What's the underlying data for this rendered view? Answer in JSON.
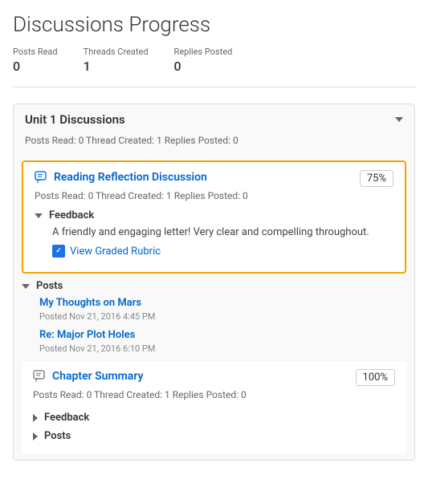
{
  "page": {
    "title": "Discussions Progress"
  },
  "stats": {
    "posts_read_label": "Posts Read",
    "threads_created_label": "Threads Created",
    "replies_posted_label": "Replies Posted",
    "posts_read_value": "0",
    "threads_created_value": "1",
    "replies_posted_value": "0"
  },
  "unit": {
    "title": "Unit 1 Discussions",
    "meta": "Posts Read: 0   Thread Created: 1   Replies Posted: 0"
  },
  "discussion1": {
    "title": "Reading Reflection Discussion",
    "meta": "Posts Read: 0   Thread Created: 1   Replies Posted: 0",
    "score": "75%",
    "feedback_label": "Feedback",
    "feedback_text": "A friendly and engaging letter! Very clear and compelling throughout.",
    "rubric_link_text": "View Graded Rubric",
    "posts_label": "Posts",
    "posts": [
      {
        "title": "My Thoughts on Mars",
        "date": "Posted Nov 21, 2016 4:45 PM"
      },
      {
        "title": "Re: Major Plot Holes",
        "date": "Posted Nov 21, 2016 6:10 PM"
      }
    ]
  },
  "discussion2": {
    "title": "Chapter Summary",
    "meta": "Posts Read: 0   Thread Created: 1   Replies Posted: 0",
    "score": "100%",
    "feedback_label": "Feedback",
    "posts_label": "Posts"
  }
}
